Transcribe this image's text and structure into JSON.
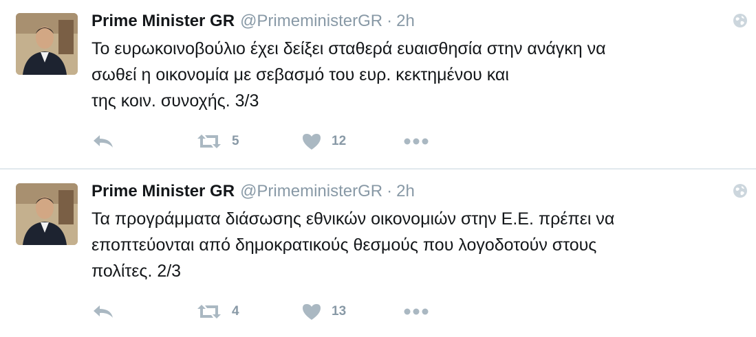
{
  "tweets": [
    {
      "fullname": "Prime Minister GR",
      "username": "@PrimeministerGR",
      "separator": "·",
      "time": "2h",
      "text": "Το ευρωκοινοβούλιο έχει δείξει σταθερά ευαισθησία στην ανάγκη να\nσωθεί η οικονομία με σεβασμό του ευρ. κεκτημένου και\nτης κοιν. συνοχής. 3/3",
      "retweet_count": "5",
      "like_count": "12"
    },
    {
      "fullname": "Prime Minister GR",
      "username": "@PrimeministerGR",
      "separator": "·",
      "time": "2h",
      "text": "Τα προγράμματα διάσωσης εθνικών οικονομιών στην Ε.Ε. πρέπει να\nεποπτεύονται από δημοκρατικούς θεσμούς που λογοδοτούν στους\nπολίτες. 2/3",
      "retweet_count": "4",
      "like_count": "13"
    }
  ],
  "icons": {
    "reply": "reply-icon",
    "retweet": "retweet-icon",
    "like": "heart-icon",
    "more": "more-dots-icon",
    "globe": "globe-icon"
  },
  "colors": {
    "icon": "#aab8c2",
    "meta": "#8899a6",
    "text": "#14171a",
    "divider": "#e1e8ed"
  }
}
